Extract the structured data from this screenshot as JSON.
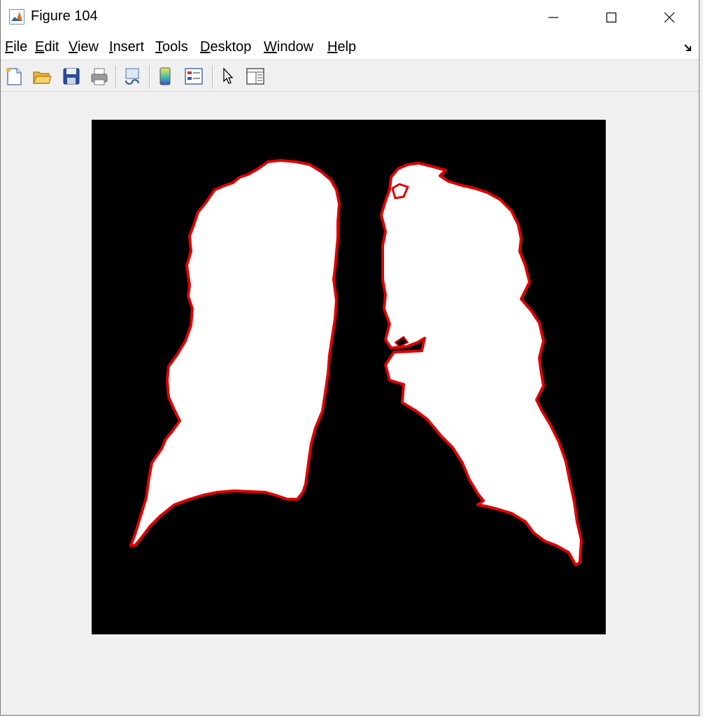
{
  "window": {
    "title": "Figure 104",
    "icon": "matlab-figure-icon",
    "controls": [
      "minimize-icon",
      "maximize-icon",
      "close-icon"
    ]
  },
  "menu": {
    "items": [
      {
        "mnemonic": "F",
        "rest": "ile"
      },
      {
        "mnemonic": "E",
        "rest": "dit"
      },
      {
        "mnemonic": "V",
        "rest": "iew"
      },
      {
        "mnemonic": "I",
        "rest": "nsert"
      },
      {
        "mnemonic": "T",
        "rest": "ools"
      },
      {
        "mnemonic": "D",
        "rest": "esktop"
      },
      {
        "mnemonic": "W",
        "rest": "indow"
      },
      {
        "mnemonic": "H",
        "rest": "elp"
      }
    ],
    "dock_icon": "dock-arrow-icon"
  },
  "toolbar": {
    "buttons": [
      "new-figure-icon",
      "open-file-icon",
      "save-icon",
      "print-icon",
      "link-plot-icon",
      "insert-colorbar-icon",
      "insert-legend-icon",
      "edit-plot-pointer-icon",
      "property-inspector-icon"
    ]
  },
  "figure": {
    "background": "#000000",
    "mask_fill": "#ffffff",
    "boundary_color": "#e00000"
  }
}
